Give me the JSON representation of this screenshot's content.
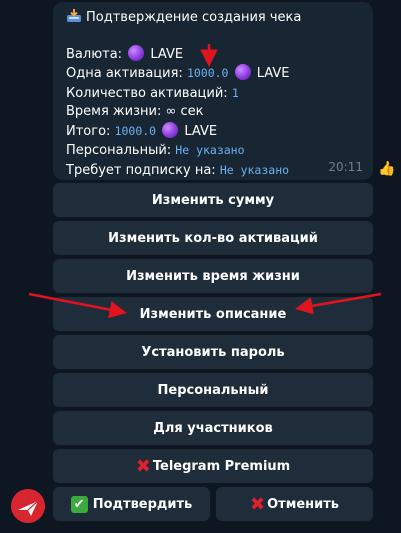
{
  "message": {
    "title": "Подтверждение создания чека",
    "currency_label": "Валюта:",
    "currency_value": "LAVE",
    "one_activation_label": "Одна активация:",
    "one_activation_amount": "1000.0",
    "one_activation_currency": "LAVE",
    "activations_label": "Количество активаций:",
    "activations_value": "1",
    "lifetime_label": "Время жизни:",
    "lifetime_value": "∞ сек",
    "total_label": "Итого:",
    "total_amount": "1000.0",
    "total_currency": "LAVE",
    "personal_label": "Персональный:",
    "personal_value": "Не указано",
    "subscription_label": "Требует подписку на:",
    "subscription_value": "Не указано",
    "time": "20:11"
  },
  "buttons": {
    "change_sum": "Изменить сумму",
    "change_activations": "Изменить кол-во активаций",
    "change_lifetime": "Изменить время жизни",
    "change_description": "Изменить описание",
    "set_password": "Установить пароль",
    "personal": "Персональный",
    "for_members": "Для участников",
    "telegram_premium": "Telegram Premium",
    "confirm": "Подтвердить",
    "cancel": "Отменить"
  },
  "icons": {
    "title_icon": "inbox-tray-icon",
    "coin_icon": "purple-circle-icon",
    "reaction": "thumbs-up-icon",
    "premium_mark": "red-cross-icon",
    "confirm_mark": "green-check-icon",
    "cancel_mark": "red-cross-icon"
  },
  "colors": {
    "background": "#0e1621",
    "bubble": "#182533",
    "button": "#1f2c3a",
    "link_mono": "#6ab2f2",
    "arrow": "#e0141e"
  }
}
